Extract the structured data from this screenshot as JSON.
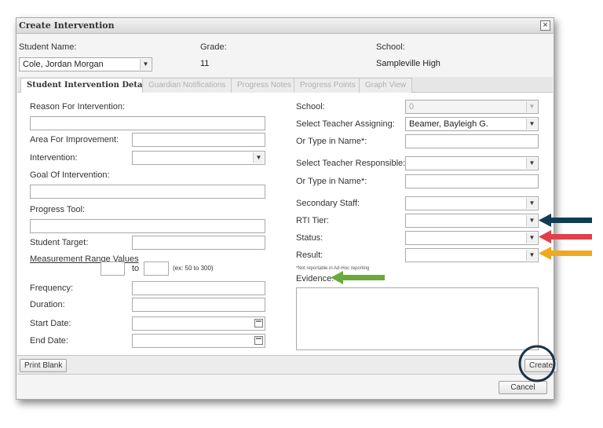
{
  "window": {
    "title": "Create Intervention",
    "close_label": "×"
  },
  "header": {
    "student_name_label": "Student Name:",
    "student_name_value": "Cole, Jordan Morgan",
    "grade_label": "Grade:",
    "grade_value": "11",
    "school_label": "School:",
    "school_value": "Sampleville High"
  },
  "tabs": [
    {
      "label": "Student Intervention Details",
      "active": true
    },
    {
      "label": "Guardian Notifications",
      "active": false
    },
    {
      "label": "Progress Notes",
      "active": false
    },
    {
      "label": "Progress Points",
      "active": false
    },
    {
      "label": "Graph View",
      "active": false
    }
  ],
  "left": {
    "reason_label": "Reason For Intervention:",
    "area_label": "Area For Improvement:",
    "intervention_label": "Intervention:",
    "goal_label": "Goal Of Intervention:",
    "progress_tool_label": "Progress Tool:",
    "student_target_label": "Student Target:",
    "measurement_label": "Measurement Range Values",
    "to_label": "to",
    "range_example": "(ex: 50 to 300)",
    "frequency_label": "Frequency:",
    "duration_label": "Duration:",
    "start_date_label": "Start Date:",
    "end_date_label": "End Date:"
  },
  "right": {
    "school_label": "School:",
    "school_value": "0",
    "teacher_assigning_label": "Select Teacher Assigning:",
    "teacher_assigning_value": "Beamer, Bayleigh G.",
    "type_name_label": "Or Type in Name*:",
    "teacher_responsible_label": "Select Teacher Responsible:",
    "type_name_label_2": "Or Type in Name*:",
    "secondary_staff_label": "Secondary Staff:",
    "rti_tier_label": "RTI Tier:",
    "status_label": "Status:",
    "result_label": "Result:",
    "not_reportable_note": "*Not reportable in Ad-Hoc reporting",
    "evidence_label": "Evidence:"
  },
  "buttons": {
    "print_blank": "Print Blank",
    "create": "Create",
    "cancel": "Cancel"
  },
  "annotations": {
    "rti_arrow_color": "#123b52",
    "status_arrow_color": "#e0404a",
    "result_arrow_color": "#f0a81e",
    "evidence_arrow_color": "#6aaa3a",
    "create_circle_color": "#1d3347"
  }
}
